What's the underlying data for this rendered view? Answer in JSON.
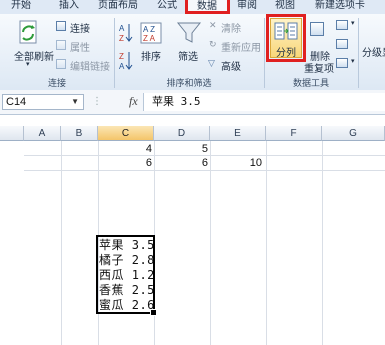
{
  "tabs": [
    {
      "label": "开始"
    },
    {
      "label": "插入"
    },
    {
      "label": "页面布局"
    },
    {
      "label": "公式"
    },
    {
      "label": "数据"
    },
    {
      "label": "审阅"
    },
    {
      "label": "视图"
    },
    {
      "label": "新建选项卡"
    }
  ],
  "ribbon": {
    "connections_group": {
      "refresh_all": "全部刷新",
      "connections": "连接",
      "properties": "属性",
      "edit_links": "编辑链接",
      "label": "连接"
    },
    "sort_filter_group": {
      "sort": "排序",
      "filter": "筛选",
      "clear": "清除",
      "reapply": "重新应用",
      "advanced": "高级",
      "label": "排序和筛选"
    },
    "data_tools_group": {
      "text_to_columns": "分列",
      "remove_duplicates": "删除",
      "duplicates_suffix": "重复项",
      "label": "数据工具"
    },
    "outline_group": {
      "ungroup": "分级显"
    },
    "accent_color": "#e02020"
  },
  "formula_bar": {
    "name_box": "C14",
    "fx": "fx",
    "content": "苹果 3.5"
  },
  "grid": {
    "columns": [
      "A",
      "B",
      "C",
      "D",
      "E",
      "F",
      "G"
    ],
    "selected_column": "C",
    "cells": {
      "C_r1": "4",
      "D_r1": "5",
      "C_r2": "6",
      "D_r2": "6",
      "E_r2": "10",
      "list": [
        "苹果 3.5",
        "橘子 2.8",
        "西瓜 1.2",
        "香蕉 2.5",
        "蜜瓜 2.6"
      ]
    }
  }
}
